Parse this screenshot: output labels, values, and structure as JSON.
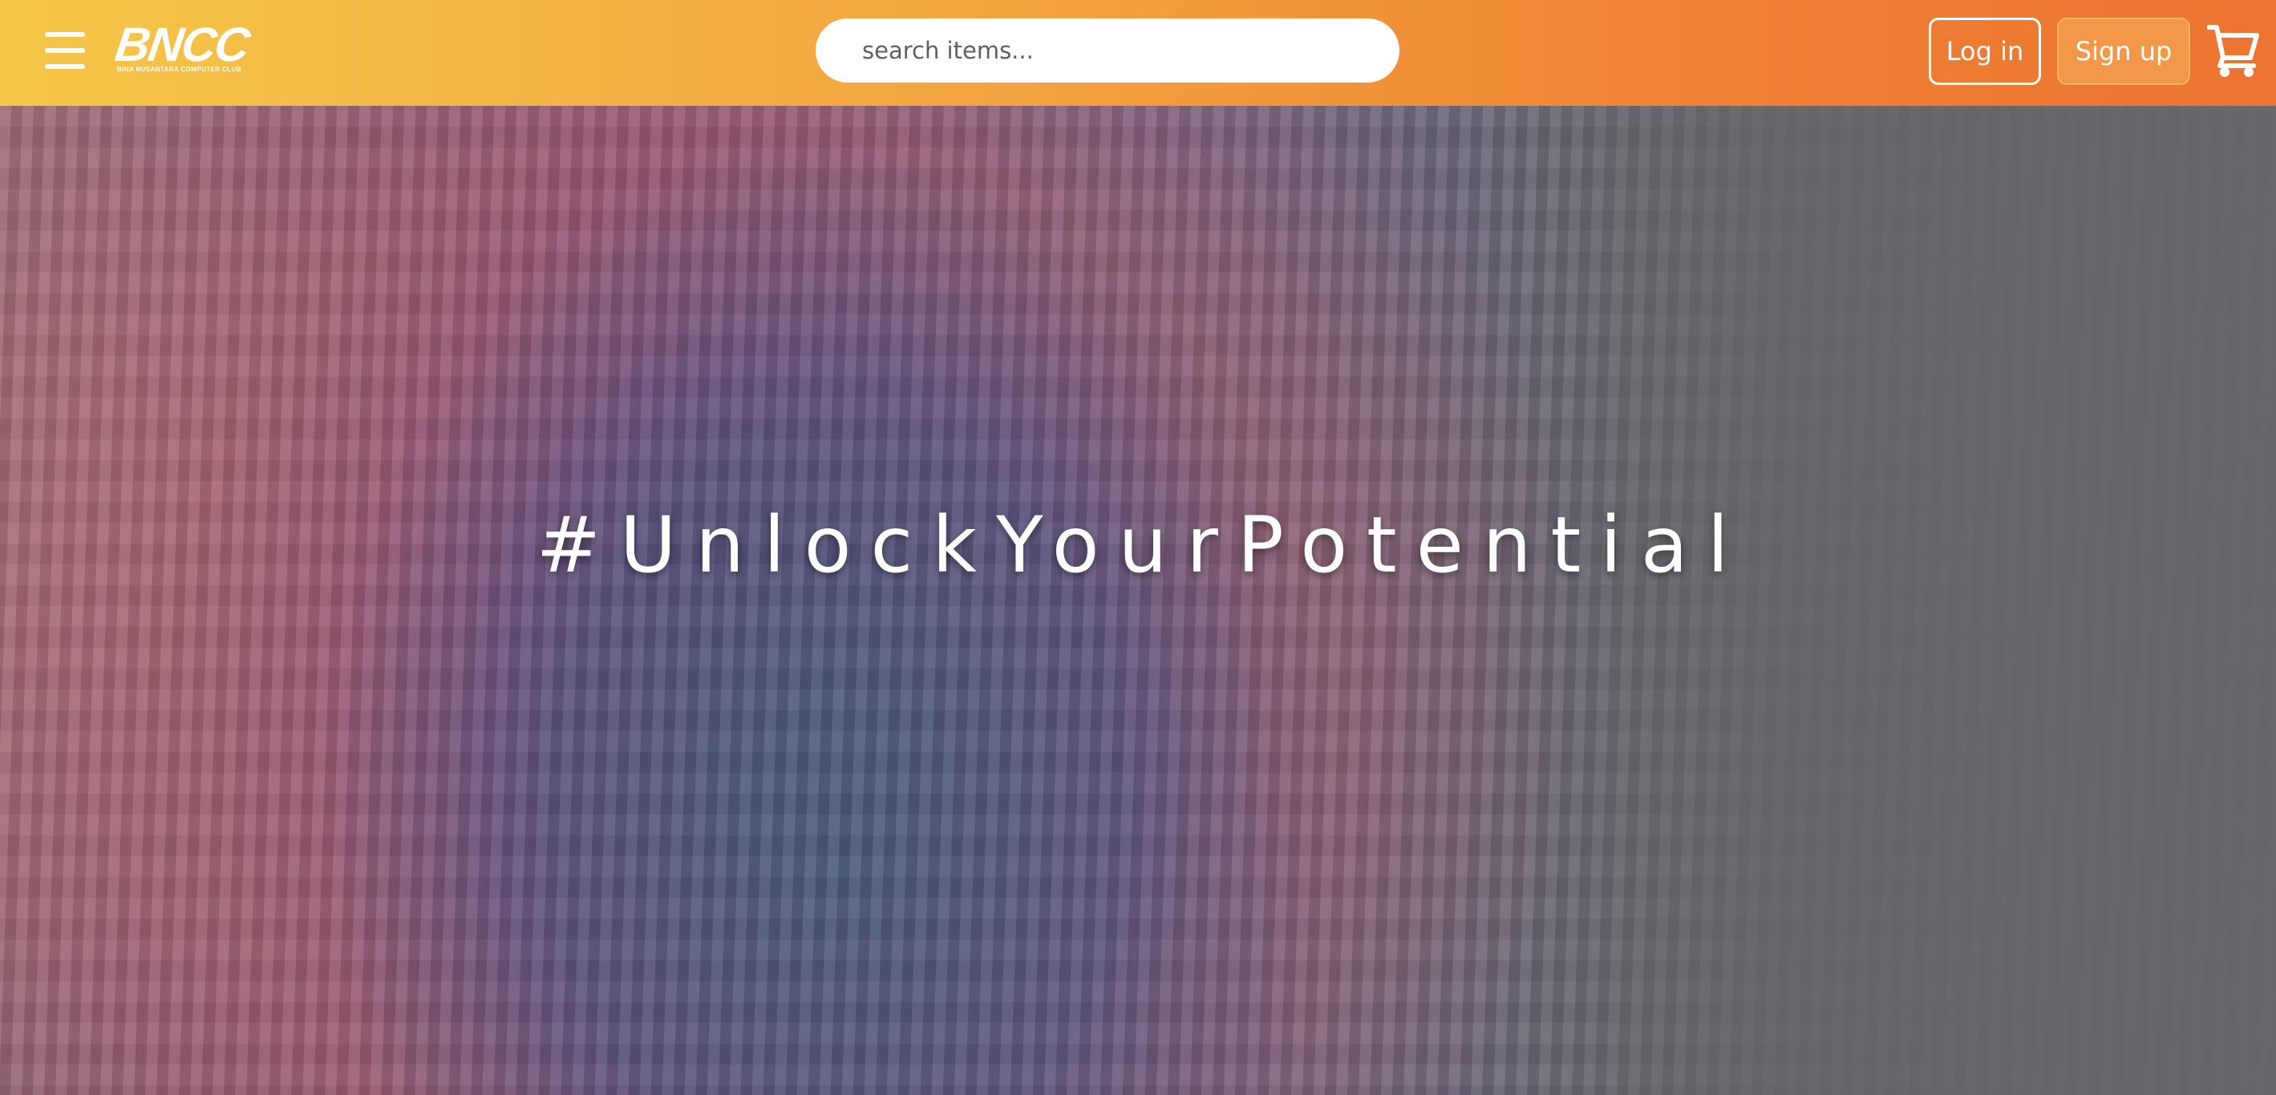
{
  "header": {
    "menu_icon": "hamburger-menu-icon",
    "logo": {
      "text": "BNCC",
      "tagline": "BINA NUSANTARA COMPUTER CLUB"
    },
    "search": {
      "placeholder": "search items..."
    },
    "login_label": "Log in",
    "signup_label": "Sign up",
    "cart_icon": "shopping-cart-icon"
  },
  "hero": {
    "title": "#UnlockYourPotential"
  },
  "colors": {
    "header_gradient_start": "#f6c748",
    "header_gradient_end": "#ec7330",
    "signup_bg": "#f39849",
    "text_white": "#ffffff"
  }
}
